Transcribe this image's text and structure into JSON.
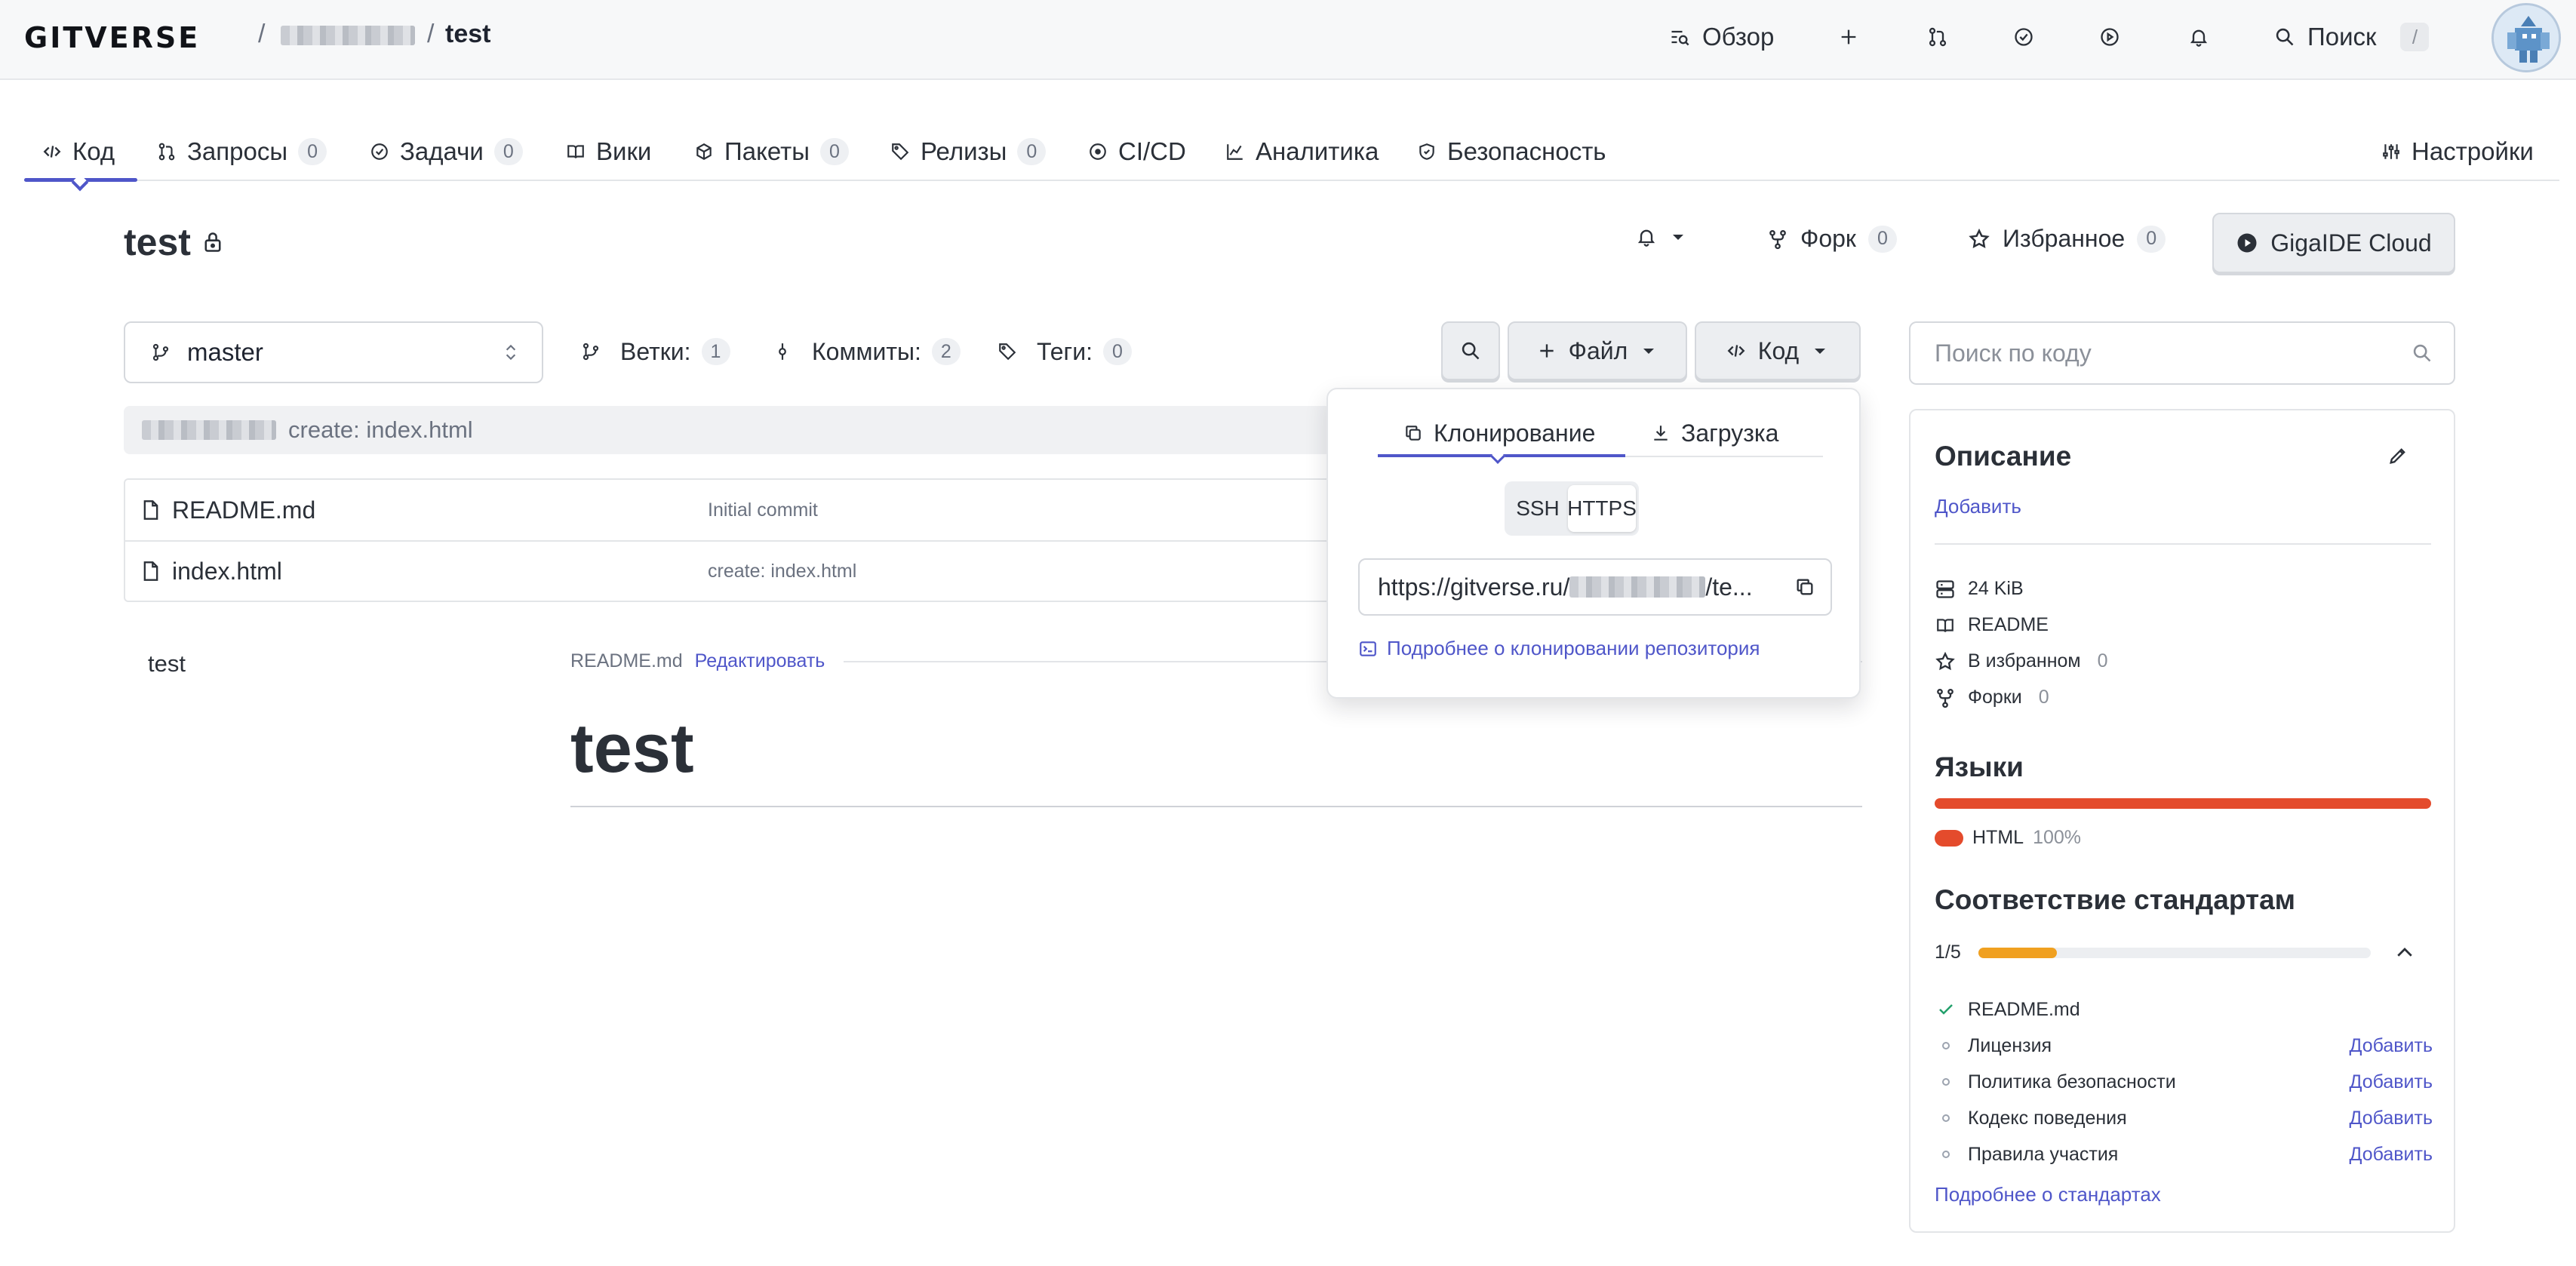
{
  "header": {
    "logo": "GITVERSE",
    "sep1": "/",
    "sep2": "/",
    "repo": "test",
    "nav": {
      "overview": "Обзор",
      "search": "Поиск",
      "search_key": "/"
    }
  },
  "tabs": [
    {
      "label": "Код"
    },
    {
      "label": "Запросы",
      "count": "0"
    },
    {
      "label": "Задачи",
      "count": "0"
    },
    {
      "label": "Вики"
    },
    {
      "label": "Пакеты",
      "count": "0"
    },
    {
      "label": "Релизы",
      "count": "0"
    },
    {
      "label": "CI/CD"
    },
    {
      "label": "Аналитика"
    },
    {
      "label": "Безопасность"
    },
    {
      "label": "Настройки"
    }
  ],
  "repo": {
    "title": "test",
    "fork_label": "Форк",
    "fork_count": "0",
    "fav_label": "Избранное",
    "fav_count": "0",
    "ide_label": "GigaIDE Cloud"
  },
  "branch_row": {
    "branch": "master",
    "branches_label": "Ветки:",
    "branches_count": "1",
    "commits_label": "Коммиты:",
    "commits_count": "2",
    "tags_label": "Теги:",
    "tags_count": "0",
    "file_label": "Файл",
    "code_label": "Код"
  },
  "last_commit": {
    "message": "create: index.html"
  },
  "files": [
    {
      "name": "README.md",
      "message": "Initial commit"
    },
    {
      "name": "index.html",
      "message": "create: index.html"
    }
  ],
  "readme": {
    "side": "test",
    "filename": "README.md",
    "edit": "Редактировать",
    "heading": "test"
  },
  "clone_popover": {
    "tab_clone": "Клонирование",
    "tab_download": "Загрузка",
    "ssh": "SSH",
    "https": "HTTPS",
    "url_prefix": "https://gitverse.ru/",
    "url_suffix": "/te...",
    "help": "Подробнее о клонировании репозитория"
  },
  "sidebar": {
    "search_placeholder": "Поиск по коду",
    "description_title": "Описание",
    "description_add": "Добавить",
    "size": "24 KiB",
    "readme": "README",
    "favorites_label": "В избранном",
    "favorites_count": "0",
    "forks_label": "Форки",
    "forks_count": "0",
    "languages_title": "Языки",
    "language": "HTML",
    "language_pct": "100%",
    "language_share": 1.0,
    "standards_title": "Соответствие стандартам",
    "standards_score": "1/5",
    "standards_fraction": 0.2,
    "standards": [
      {
        "label": "README.md",
        "done": true
      },
      {
        "label": "Лицензия",
        "add": "Добавить"
      },
      {
        "label": "Политика безопасности",
        "add": "Добавить"
      },
      {
        "label": "Кодекс поведения",
        "add": "Добавить"
      },
      {
        "label": "Правила участия",
        "add": "Добавить"
      }
    ],
    "standards_more": "Подробнее о стандартах"
  },
  "colors": {
    "accent": "#4f56c9",
    "language_html": "#e44b2c",
    "progress": "#f0a020"
  }
}
